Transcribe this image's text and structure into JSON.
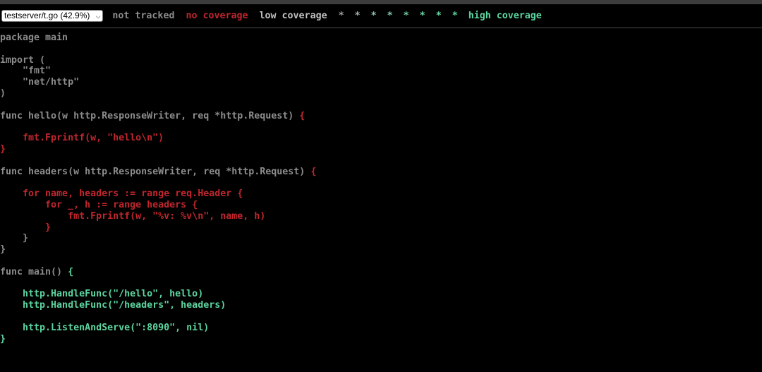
{
  "file_selector": {
    "selected": "testserver/t.go (42.9%)"
  },
  "legend": {
    "not_tracked": "not tracked",
    "no_coverage": "no coverage",
    "low_coverage": "low coverage",
    "stars": [
      "*",
      "*",
      "*",
      "*",
      "*",
      "*",
      "*",
      "*"
    ],
    "high_coverage": "high coverage"
  },
  "colors": {
    "background": "#000000",
    "not_tracked": "#8c8c8c",
    "no_coverage": "#c0262d",
    "low_coverage": "#c0c0c0",
    "high_coverage": "#5cd6a0",
    "star_shades": [
      "#a0a0a0",
      "#a0b4a8",
      "#8fc3ab",
      "#80cda8",
      "#73d3a6",
      "#6ad8a8",
      "#64dba6",
      "#5cd6a0"
    ]
  },
  "code_lines": [
    {
      "text": "package main",
      "cov": "none"
    },
    {
      "text": "",
      "cov": "none"
    },
    {
      "text": "import (",
      "cov": "none"
    },
    {
      "text": "    \"fmt\"",
      "cov": "none"
    },
    {
      "text": "    \"net/http\"",
      "cov": "none"
    },
    {
      "text": ")",
      "cov": "none"
    },
    {
      "text": "",
      "cov": "none"
    },
    {
      "text": "func hello(w http.ResponseWriter, req *http.Request) ",
      "cov": "none",
      "tail": "{",
      "tail_cov": "red"
    },
    {
      "text": "",
      "cov": "none"
    },
    {
      "text": "    fmt.Fprintf(w, \"hello\\n\")",
      "cov": "red"
    },
    {
      "text": "}",
      "cov": "red"
    },
    {
      "text": "",
      "cov": "none"
    },
    {
      "text": "func headers(w http.ResponseWriter, req *http.Request) ",
      "cov": "none",
      "tail": "{",
      "tail_cov": "red"
    },
    {
      "text": "",
      "cov": "none"
    },
    {
      "text": "    for name, headers := range req.Header {",
      "cov": "red"
    },
    {
      "text": "        for _, h := range headers {",
      "cov": "red"
    },
    {
      "text": "            fmt.Fprintf(w, \"%v: %v\\n\", name, h)",
      "cov": "red"
    },
    {
      "text": "        }",
      "cov": "red"
    },
    {
      "text": "    }",
      "cov": "none"
    },
    {
      "text": "}",
      "cov": "none"
    },
    {
      "text": "",
      "cov": "none"
    },
    {
      "text": "func main() ",
      "cov": "none",
      "tail": "{",
      "tail_cov": "green"
    },
    {
      "text": "",
      "cov": "none"
    },
    {
      "text": "    http.HandleFunc(\"/hello\", hello)",
      "cov": "green"
    },
    {
      "text": "    http.HandleFunc(\"/headers\", headers)",
      "cov": "green"
    },
    {
      "text": "",
      "cov": "none"
    },
    {
      "text": "    http.ListenAndServe(\":8090\", nil)",
      "cov": "green"
    },
    {
      "text": "}",
      "cov": "green"
    }
  ]
}
